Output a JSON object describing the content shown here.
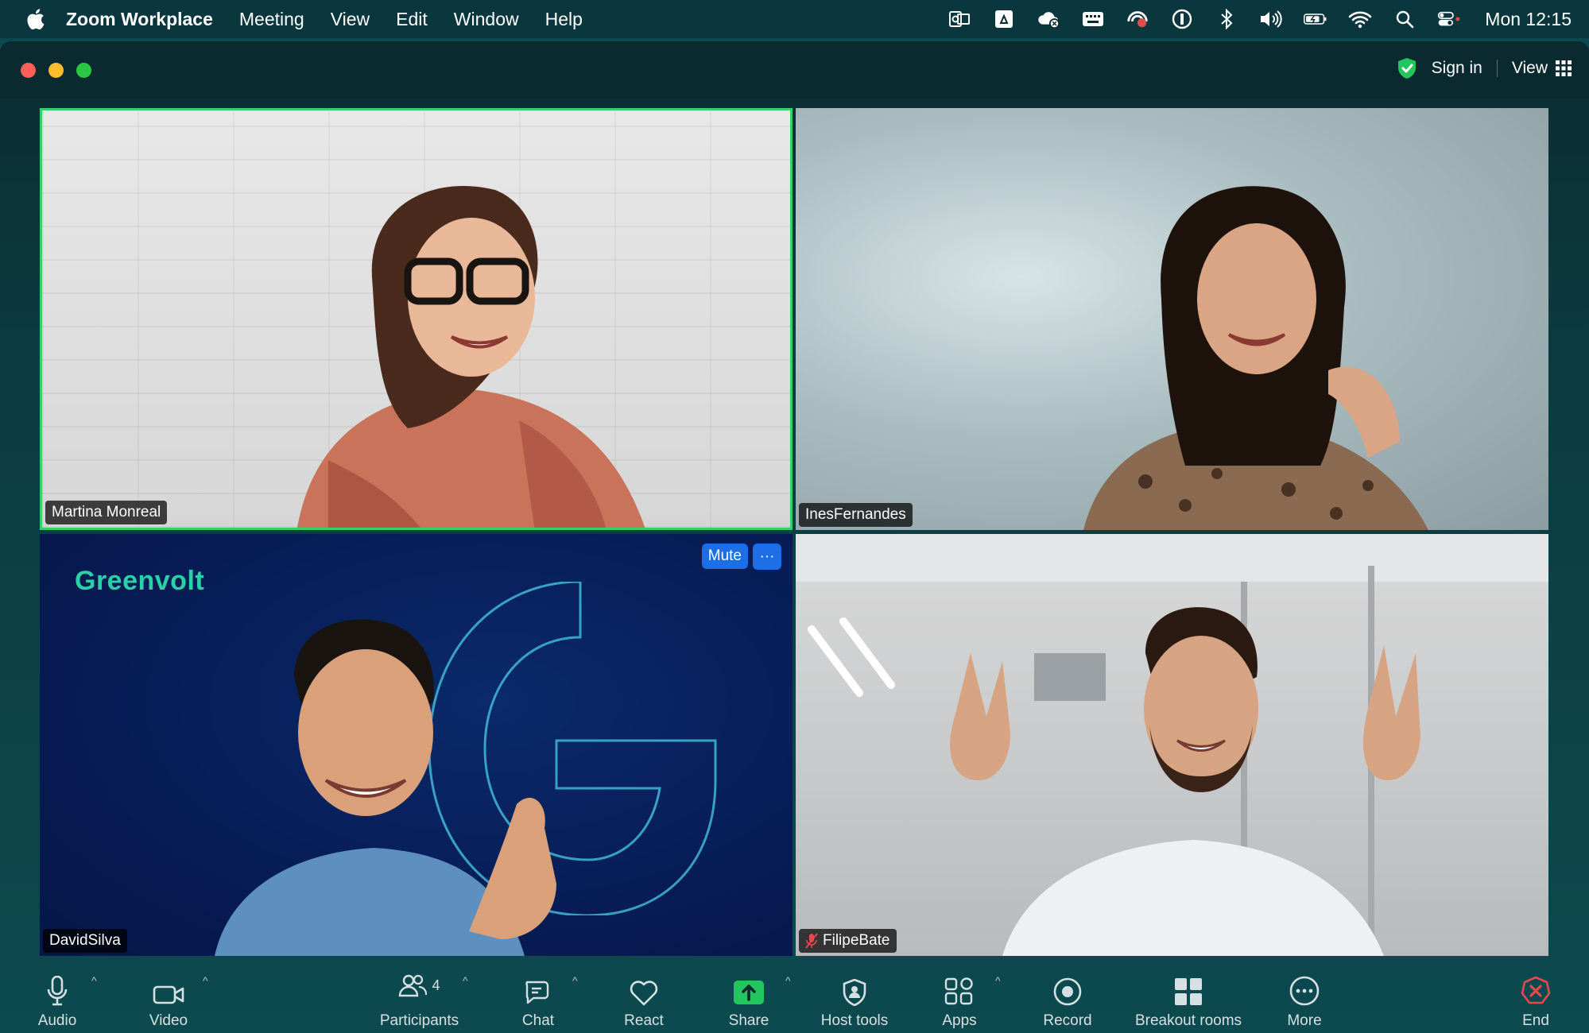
{
  "menubar": {
    "app_name": "Zoom Workplace",
    "menus": [
      "Meeting",
      "View",
      "Edit",
      "Window",
      "Help"
    ],
    "clock": "Mon 12:15"
  },
  "titlebar": {
    "sign_in": "Sign in",
    "view": "View"
  },
  "tiles": [
    {
      "name": "Martina Monreal"
    },
    {
      "name": "InesFernandes"
    },
    {
      "name": "DavidSilva",
      "brand": "Greenvolt",
      "mute": "Mute",
      "more": "···"
    },
    {
      "name": "FilipeBate"
    }
  ],
  "toolbar": {
    "audio": "Audio",
    "video": "Video",
    "participants": "Participants",
    "participants_count": "4",
    "chat": "Chat",
    "react": "React",
    "share": "Share",
    "host_tools": "Host tools",
    "apps": "Apps",
    "record": "Record",
    "breakout_rooms": "Breakout rooms",
    "more": "More",
    "end": "End"
  },
  "colors": {
    "active_speaker_border": "#35d06c",
    "share_green": "#22c55e",
    "end_red": "#e5484d",
    "mute_blue": "#1d6fe8"
  }
}
